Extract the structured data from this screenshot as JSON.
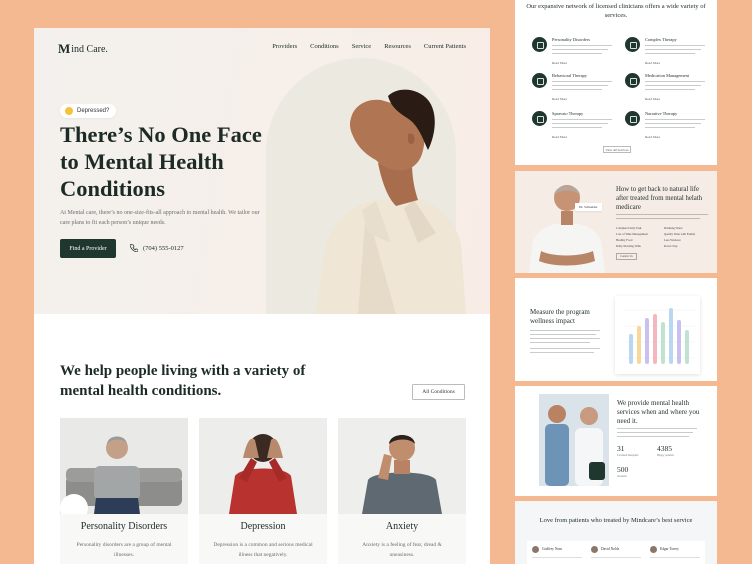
{
  "main": {
    "brand": {
      "mark": "M",
      "text": "ind Care."
    },
    "nav": [
      "Providers",
      "Conditions",
      "Service",
      "Resources",
      "Current Patients"
    ],
    "hero": {
      "badge": "Depressed?",
      "title": "There’s No One Face to Mental Health Conditions",
      "text": "At Mental care, there’s no one-size-fits-all approach to mental health. We tailor our care plans to fit each person’s unique needs.",
      "cta": "Find a Provider",
      "phone": "(704) 555-0127"
    },
    "conditions": {
      "title": "We help people living with a variety of mental health conditions.",
      "all_button": "All Conditions",
      "cards": [
        {
          "title": "Personality Disorders",
          "desc": "Personality disorders are a group of mental illnesses."
        },
        {
          "title": "Depression",
          "desc": "Depression is a common and serious medical illness that negatively."
        },
        {
          "title": "Anxiety",
          "desc": "Anxiety is a feeling of fear, dread & uneasiness."
        }
      ]
    }
  },
  "preview": {
    "services": {
      "heading": "Our expansive network of licensed clinicians offers a wide variety of services.",
      "items": [
        {
          "title": "Personality Disorders",
          "more": "Read More"
        },
        {
          "title": "Complex Therapy",
          "more": "Read More"
        },
        {
          "title": "Behavioral Therapy",
          "more": "Read More"
        },
        {
          "title": "Medication Management",
          "more": "Read More"
        },
        {
          "title": "Spravato Therapy",
          "more": "Read More"
        },
        {
          "title": "Narrative Therapy",
          "more": "Read More"
        }
      ],
      "view_all": "View All Services"
    },
    "medicare": {
      "title": "How to get back to natural life after treated from mental helath medicare",
      "doctor": "Dr. Schneider",
      "list": [
        "Complete Daily Task",
        "Drinking Water",
        "Lots of Time Management",
        "Quality Time with Family",
        "Healthy Food",
        "Less Workout",
        "Daily Morning Walk",
        "Power Nap"
      ],
      "button": "Contact Us"
    },
    "wellness": {
      "title": "Measure the program wellness impact",
      "chart_labels": [
        "Jan",
        "Feb",
        "Mar",
        "Apr",
        "May",
        "Jun",
        "Jul",
        "Aug"
      ]
    },
    "services_when": {
      "title": "We provide mental health services when and where you need it.",
      "stats": [
        {
          "value": "31",
          "label": "Licensed therapists"
        },
        {
          "value": "4385",
          "label": "Happy patients"
        },
        {
          "value": "500",
          "label": "Sessions"
        }
      ]
    },
    "testimonials": {
      "title": "Love from patients who treated by Mindcare’s best service",
      "names": [
        "Godfrey Nom",
        "David Nolds",
        "Edgar Torrey"
      ]
    }
  },
  "colors": {
    "background": "#f4b990",
    "brand_dark": "#20372f",
    "hero_bg": "#f4efea"
  }
}
